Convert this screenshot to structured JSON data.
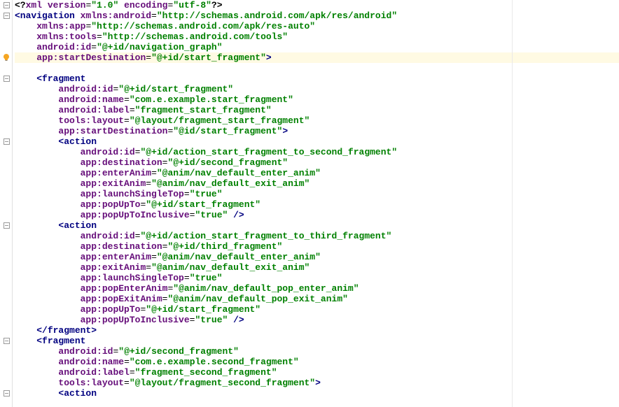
{
  "lines": [
    {
      "indent": 0,
      "segs": [
        {
          "t": "<?",
          "c": "c-decl"
        },
        {
          "t": "xml version",
          "c": "c-attr"
        },
        {
          "t": "=",
          "c": "c-punct"
        },
        {
          "t": "\"1.0\"",
          "c": "c-val"
        },
        {
          "t": " ",
          "c": ""
        },
        {
          "t": "encoding",
          "c": "c-attr"
        },
        {
          "t": "=",
          "c": "c-punct"
        },
        {
          "t": "\"utf-8\"",
          "c": "c-val"
        },
        {
          "t": "?>",
          "c": "c-decl"
        }
      ]
    },
    {
      "indent": 0,
      "segs": [
        {
          "t": "<navigation ",
          "c": "c-tag"
        },
        {
          "t": "xmlns:",
          "c": "c-ns"
        },
        {
          "t": "android",
          "c": "c-attr"
        },
        {
          "t": "=",
          "c": "c-punct"
        },
        {
          "t": "\"http://schemas.android.com/apk/res/android\"",
          "c": "c-val"
        }
      ]
    },
    {
      "indent": 1,
      "segs": [
        {
          "t": "xmlns:",
          "c": "c-ns"
        },
        {
          "t": "app",
          "c": "c-attr"
        },
        {
          "t": "=",
          "c": "c-punct"
        },
        {
          "t": "\"http://schemas.android.com/apk/res-auto\"",
          "c": "c-val"
        }
      ]
    },
    {
      "indent": 1,
      "segs": [
        {
          "t": "xmlns:",
          "c": "c-ns"
        },
        {
          "t": "tools",
          "c": "c-attr"
        },
        {
          "t": "=",
          "c": "c-punct"
        },
        {
          "t": "\"http://schemas.android.com/tools\"",
          "c": "c-val"
        }
      ]
    },
    {
      "indent": 1,
      "segs": [
        {
          "t": "android:",
          "c": "c-ns"
        },
        {
          "t": "id",
          "c": "c-attr"
        },
        {
          "t": "=",
          "c": "c-punct"
        },
        {
          "t": "\"@+id/navigation_graph\"",
          "c": "c-val"
        }
      ]
    },
    {
      "indent": 1,
      "hl": true,
      "segs": [
        {
          "t": "app:",
          "c": "c-ns"
        },
        {
          "t": "startDestination",
          "c": "c-attr"
        },
        {
          "t": "=",
          "c": "c-punct"
        },
        {
          "t": "\"@+id/start_fragment\"",
          "c": "c-val"
        },
        {
          "t": ">",
          "c": "c-tag"
        }
      ]
    },
    {
      "indent": 0,
      "segs": []
    },
    {
      "indent": 1,
      "segs": [
        {
          "t": "<fragment",
          "c": "c-tag"
        }
      ]
    },
    {
      "indent": 2,
      "segs": [
        {
          "t": "android:",
          "c": "c-ns"
        },
        {
          "t": "id",
          "c": "c-attr"
        },
        {
          "t": "=",
          "c": "c-punct"
        },
        {
          "t": "\"@+id/start_fragment\"",
          "c": "c-val"
        }
      ]
    },
    {
      "indent": 2,
      "segs": [
        {
          "t": "android:",
          "c": "c-ns"
        },
        {
          "t": "name",
          "c": "c-attr"
        },
        {
          "t": "=",
          "c": "c-punct"
        },
        {
          "t": "\"com.e.example.start_fragment\"",
          "c": "c-val"
        }
      ]
    },
    {
      "indent": 2,
      "segs": [
        {
          "t": "android:",
          "c": "c-ns"
        },
        {
          "t": "label",
          "c": "c-attr"
        },
        {
          "t": "=",
          "c": "c-punct"
        },
        {
          "t": "\"fragment_start_fragment\"",
          "c": "c-val"
        }
      ]
    },
    {
      "indent": 2,
      "segs": [
        {
          "t": "tools:",
          "c": "c-ns"
        },
        {
          "t": "layout",
          "c": "c-attr"
        },
        {
          "t": "=",
          "c": "c-punct"
        },
        {
          "t": "\"@layout/fragment_start_fragment\"",
          "c": "c-val"
        }
      ]
    },
    {
      "indent": 2,
      "segs": [
        {
          "t": "app:",
          "c": "c-ns"
        },
        {
          "t": "startDestination",
          "c": "c-attr"
        },
        {
          "t": "=",
          "c": "c-punct"
        },
        {
          "t": "\"@id/start_fragment\"",
          "c": "c-val"
        },
        {
          "t": ">",
          "c": "c-tag"
        }
      ]
    },
    {
      "indent": 2,
      "segs": [
        {
          "t": "<action",
          "c": "c-tag"
        }
      ]
    },
    {
      "indent": 3,
      "segs": [
        {
          "t": "android:",
          "c": "c-ns"
        },
        {
          "t": "id",
          "c": "c-attr"
        },
        {
          "t": "=",
          "c": "c-punct"
        },
        {
          "t": "\"@+id/action_start_fragment_to_second_fragment\"",
          "c": "c-val"
        }
      ]
    },
    {
      "indent": 3,
      "segs": [
        {
          "t": "app:",
          "c": "c-ns"
        },
        {
          "t": "destination",
          "c": "c-attr"
        },
        {
          "t": "=",
          "c": "c-punct"
        },
        {
          "t": "\"@+id/second_fragment\"",
          "c": "c-val"
        }
      ]
    },
    {
      "indent": 3,
      "segs": [
        {
          "t": "app:",
          "c": "c-ns"
        },
        {
          "t": "enterAnim",
          "c": "c-attr"
        },
        {
          "t": "=",
          "c": "c-punct"
        },
        {
          "t": "\"@anim/nav_default_enter_anim\"",
          "c": "c-val"
        }
      ]
    },
    {
      "indent": 3,
      "segs": [
        {
          "t": "app:",
          "c": "c-ns"
        },
        {
          "t": "exitAnim",
          "c": "c-attr"
        },
        {
          "t": "=",
          "c": "c-punct"
        },
        {
          "t": "\"@anim/nav_default_exit_anim\"",
          "c": "c-val"
        }
      ]
    },
    {
      "indent": 3,
      "segs": [
        {
          "t": "app:",
          "c": "c-ns"
        },
        {
          "t": "launchSingleTop",
          "c": "c-attr"
        },
        {
          "t": "=",
          "c": "c-punct"
        },
        {
          "t": "\"true\"",
          "c": "c-val"
        }
      ]
    },
    {
      "indent": 3,
      "segs": [
        {
          "t": "app:",
          "c": "c-ns"
        },
        {
          "t": "popUpTo",
          "c": "c-attr"
        },
        {
          "t": "=",
          "c": "c-punct"
        },
        {
          "t": "\"@+id/start_fragment\"",
          "c": "c-val"
        }
      ]
    },
    {
      "indent": 3,
      "segs": [
        {
          "t": "app:",
          "c": "c-ns"
        },
        {
          "t": "popUpToInclusive",
          "c": "c-attr"
        },
        {
          "t": "=",
          "c": "c-punct"
        },
        {
          "t": "\"true\"",
          "c": "c-val"
        },
        {
          "t": " />",
          "c": "c-tag"
        }
      ]
    },
    {
      "indent": 2,
      "segs": [
        {
          "t": "<action",
          "c": "c-tag"
        }
      ]
    },
    {
      "indent": 3,
      "segs": [
        {
          "t": "android:",
          "c": "c-ns"
        },
        {
          "t": "id",
          "c": "c-attr"
        },
        {
          "t": "=",
          "c": "c-punct"
        },
        {
          "t": "\"@+id/action_start_fragment_to_third_fragment\"",
          "c": "c-val"
        }
      ]
    },
    {
      "indent": 3,
      "segs": [
        {
          "t": "app:",
          "c": "c-ns"
        },
        {
          "t": "destination",
          "c": "c-attr"
        },
        {
          "t": "=",
          "c": "c-punct"
        },
        {
          "t": "\"@+id/third_fragment\"",
          "c": "c-val"
        }
      ]
    },
    {
      "indent": 3,
      "segs": [
        {
          "t": "app:",
          "c": "c-ns"
        },
        {
          "t": "enterAnim",
          "c": "c-attr"
        },
        {
          "t": "=",
          "c": "c-punct"
        },
        {
          "t": "\"@anim/nav_default_enter_anim\"",
          "c": "c-val"
        }
      ]
    },
    {
      "indent": 3,
      "segs": [
        {
          "t": "app:",
          "c": "c-ns"
        },
        {
          "t": "exitAnim",
          "c": "c-attr"
        },
        {
          "t": "=",
          "c": "c-punct"
        },
        {
          "t": "\"@anim/nav_default_exit_anim\"",
          "c": "c-val"
        }
      ]
    },
    {
      "indent": 3,
      "segs": [
        {
          "t": "app:",
          "c": "c-ns"
        },
        {
          "t": "launchSingleTop",
          "c": "c-attr"
        },
        {
          "t": "=",
          "c": "c-punct"
        },
        {
          "t": "\"true\"",
          "c": "c-val"
        }
      ]
    },
    {
      "indent": 3,
      "segs": [
        {
          "t": "app:",
          "c": "c-ns"
        },
        {
          "t": "popEnterAnim",
          "c": "c-attr"
        },
        {
          "t": "=",
          "c": "c-punct"
        },
        {
          "t": "\"@anim/nav_default_pop_enter_anim\"",
          "c": "c-val"
        }
      ]
    },
    {
      "indent": 3,
      "segs": [
        {
          "t": "app:",
          "c": "c-ns"
        },
        {
          "t": "popExitAnim",
          "c": "c-attr"
        },
        {
          "t": "=",
          "c": "c-punct"
        },
        {
          "t": "\"@anim/nav_default_pop_exit_anim\"",
          "c": "c-val"
        }
      ]
    },
    {
      "indent": 3,
      "segs": [
        {
          "t": "app:",
          "c": "c-ns"
        },
        {
          "t": "popUpTo",
          "c": "c-attr"
        },
        {
          "t": "=",
          "c": "c-punct"
        },
        {
          "t": "\"@+id/start_fragment\"",
          "c": "c-val"
        }
      ]
    },
    {
      "indent": 3,
      "segs": [
        {
          "t": "app:",
          "c": "c-ns"
        },
        {
          "t": "popUpToInclusive",
          "c": "c-attr"
        },
        {
          "t": "=",
          "c": "c-punct"
        },
        {
          "t": "\"true\"",
          "c": "c-val"
        },
        {
          "t": " />",
          "c": "c-tag"
        }
      ]
    },
    {
      "indent": 1,
      "segs": [
        {
          "t": "</fragment>",
          "c": "c-tag"
        }
      ]
    },
    {
      "indent": 1,
      "segs": [
        {
          "t": "<fragment",
          "c": "c-tag"
        }
      ]
    },
    {
      "indent": 2,
      "segs": [
        {
          "t": "android:",
          "c": "c-ns"
        },
        {
          "t": "id",
          "c": "c-attr"
        },
        {
          "t": "=",
          "c": "c-punct"
        },
        {
          "t": "\"@+id/second_fragment\"",
          "c": "c-val"
        }
      ]
    },
    {
      "indent": 2,
      "segs": [
        {
          "t": "android:",
          "c": "c-ns"
        },
        {
          "t": "name",
          "c": "c-attr"
        },
        {
          "t": "=",
          "c": "c-punct"
        },
        {
          "t": "\"com.e.example.second_fragment\"",
          "c": "c-val"
        }
      ]
    },
    {
      "indent": 2,
      "segs": [
        {
          "t": "android:",
          "c": "c-ns"
        },
        {
          "t": "label",
          "c": "c-attr"
        },
        {
          "t": "=",
          "c": "c-punct"
        },
        {
          "t": "\"fragment_second_fragment\"",
          "c": "c-val"
        }
      ]
    },
    {
      "indent": 2,
      "segs": [
        {
          "t": "tools:",
          "c": "c-ns"
        },
        {
          "t": "layout",
          "c": "c-attr"
        },
        {
          "t": "=",
          "c": "c-punct"
        },
        {
          "t": "\"@layout/fragment_second_fragment\"",
          "c": "c-val"
        },
        {
          "t": ">",
          "c": "c-tag"
        }
      ]
    },
    {
      "indent": 2,
      "segs": [
        {
          "t": "<action",
          "c": "c-tag"
        }
      ]
    }
  ],
  "gutterIcons": [
    {
      "line": 0,
      "type": "fold",
      "glyph": "⊟"
    },
    {
      "line": 1,
      "type": "fold",
      "glyph": "⊟"
    },
    {
      "line": 5,
      "type": "bulb",
      "glyph": "💡"
    },
    {
      "line": 7,
      "type": "fold",
      "glyph": "⊟"
    },
    {
      "line": 13,
      "type": "fold",
      "glyph": "⊟"
    },
    {
      "line": 21,
      "type": "fold",
      "glyph": "⊟"
    },
    {
      "line": 32,
      "type": "fold",
      "glyph": "⊟"
    },
    {
      "line": 37,
      "type": "fold",
      "glyph": "⊟"
    }
  ],
  "indentUnit": "    "
}
